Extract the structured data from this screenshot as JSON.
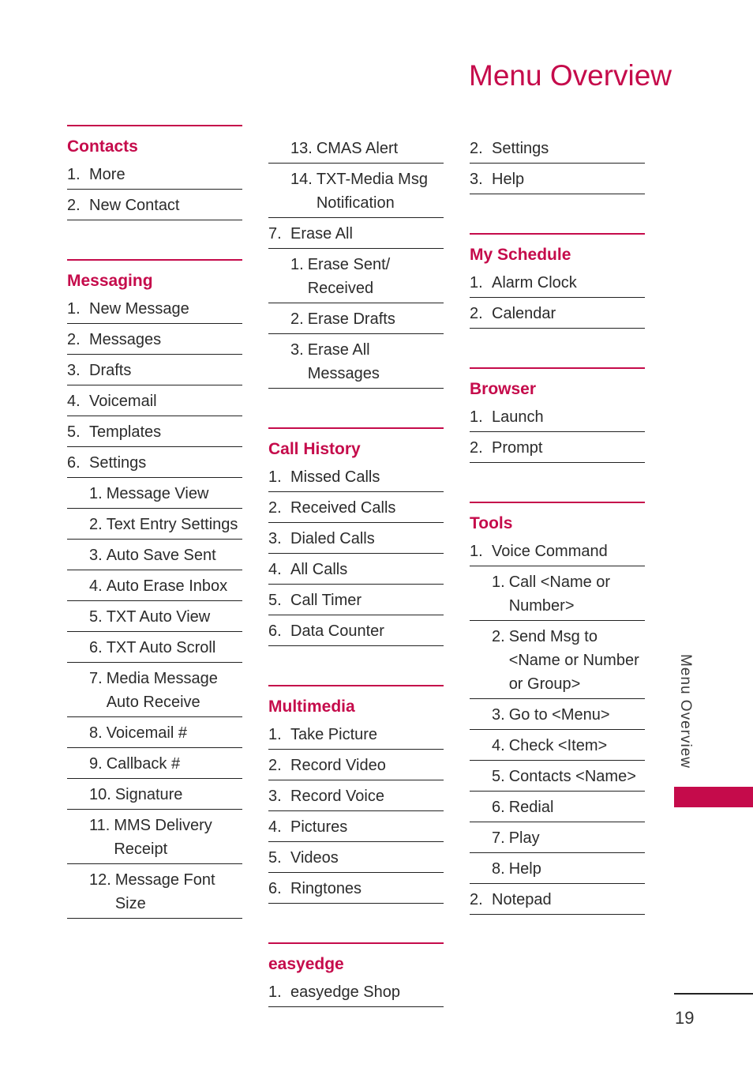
{
  "page": {
    "title": "Menu Overview",
    "side_tab_label": "Menu Overview",
    "page_number": "19",
    "accent_color": "#c50b4b"
  },
  "columns": [
    {
      "sections": [
        {
          "title": "Contacts",
          "items": [
            {
              "level": 1,
              "num": "1.",
              "label": "More"
            },
            {
              "level": 1,
              "num": "2.",
              "label": "New Contact"
            }
          ]
        },
        {
          "title": "Messaging",
          "items": [
            {
              "level": 1,
              "num": "1.",
              "label": "New Message"
            },
            {
              "level": 1,
              "num": "2.",
              "label": "Messages"
            },
            {
              "level": 1,
              "num": "3.",
              "label": "Drafts"
            },
            {
              "level": 1,
              "num": "4.",
              "label": "Voicemail"
            },
            {
              "level": 1,
              "num": "5.",
              "label": "Templates"
            },
            {
              "level": 1,
              "num": "6.",
              "label": "Settings"
            },
            {
              "level": 2,
              "num": "1.",
              "label": "Message View"
            },
            {
              "level": 2,
              "num": "2.",
              "label": "Text Entry Settings"
            },
            {
              "level": 2,
              "num": "3.",
              "label": "Auto Save Sent"
            },
            {
              "level": 2,
              "num": "4.",
              "label": "Auto Erase Inbox"
            },
            {
              "level": 2,
              "num": "5.",
              "label": "TXT Auto View"
            },
            {
              "level": 2,
              "num": "6.",
              "label": "TXT Auto Scroll"
            },
            {
              "level": 2,
              "num": "7.",
              "label": "Media Message Auto Receive"
            },
            {
              "level": 2,
              "num": "8.",
              "label": "Voicemail #"
            },
            {
              "level": 2,
              "num": "9.",
              "label": "Callback #"
            },
            {
              "level": 2,
              "num": "10.",
              "label": "Signature"
            },
            {
              "level": 2,
              "num": "11.",
              "label": "MMS Delivery Receipt"
            },
            {
              "level": 2,
              "num": "12.",
              "label": "Message Font Size"
            }
          ]
        }
      ]
    },
    {
      "sections": [
        {
          "title": "",
          "items": [
            {
              "level": 2,
              "num": "13.",
              "label": "CMAS Alert"
            },
            {
              "level": 2,
              "num": "14.",
              "label": "TXT-Media Msg Notification"
            },
            {
              "level": 1,
              "num": "7.",
              "label": "Erase All"
            },
            {
              "level": 2,
              "num": "1.",
              "label": "Erase Sent/ Received"
            },
            {
              "level": 2,
              "num": "2.",
              "label": "Erase Drafts"
            },
            {
              "level": 2,
              "num": "3.",
              "label": "Erase All Messages"
            }
          ]
        },
        {
          "title": "Call History",
          "items": [
            {
              "level": 1,
              "num": "1.",
              "label": "Missed Calls"
            },
            {
              "level": 1,
              "num": "2.",
              "label": "Received Calls"
            },
            {
              "level": 1,
              "num": "3.",
              "label": "Dialed Calls"
            },
            {
              "level": 1,
              "num": "4.",
              "label": "All Calls"
            },
            {
              "level": 1,
              "num": "5.",
              "label": "Call Timer"
            },
            {
              "level": 1,
              "num": "6.",
              "label": "Data Counter"
            }
          ]
        },
        {
          "title": "Multimedia",
          "items": [
            {
              "level": 1,
              "num": "1.",
              "label": "Take Picture"
            },
            {
              "level": 1,
              "num": "2.",
              "label": "Record Video"
            },
            {
              "level": 1,
              "num": "3.",
              "label": "Record Voice"
            },
            {
              "level": 1,
              "num": "4.",
              "label": "Pictures"
            },
            {
              "level": 1,
              "num": "5.",
              "label": "Videos"
            },
            {
              "level": 1,
              "num": "6.",
              "label": "Ringtones"
            }
          ]
        },
        {
          "title": "easyedge",
          "items": [
            {
              "level": 1,
              "num": "1.",
              "label": "easyedge Shop"
            }
          ]
        }
      ]
    },
    {
      "sections": [
        {
          "title": "",
          "items": [
            {
              "level": 1,
              "num": "2.",
              "label": "Settings"
            },
            {
              "level": 1,
              "num": "3.",
              "label": "Help"
            }
          ]
        },
        {
          "title": "My Schedule",
          "items": [
            {
              "level": 1,
              "num": "1.",
              "label": "Alarm Clock"
            },
            {
              "level": 1,
              "num": "2.",
              "label": "Calendar"
            }
          ]
        },
        {
          "title": "Browser",
          "items": [
            {
              "level": 1,
              "num": "1.",
              "label": "Launch"
            },
            {
              "level": 1,
              "num": "2.",
              "label": "Prompt"
            }
          ]
        },
        {
          "title": "Tools",
          "items": [
            {
              "level": 1,
              "num": "1.",
              "label": "Voice Command"
            },
            {
              "level": 2,
              "num": "1.",
              "label": "Call <Name or Number>"
            },
            {
              "level": 2,
              "num": "2.",
              "label": "Send Msg to <Name or Number or Group>"
            },
            {
              "level": 2,
              "num": "3.",
              "label": "Go to <Menu>"
            },
            {
              "level": 2,
              "num": "4.",
              "label": "Check <Item>"
            },
            {
              "level": 2,
              "num": "5.",
              "label": "Contacts <Name>"
            },
            {
              "level": 2,
              "num": "6.",
              "label": "Redial"
            },
            {
              "level": 2,
              "num": "7.",
              "label": "Play"
            },
            {
              "level": 2,
              "num": "8.",
              "label": "Help"
            },
            {
              "level": 1,
              "num": "2.",
              "label": "Notepad"
            }
          ]
        }
      ]
    }
  ]
}
